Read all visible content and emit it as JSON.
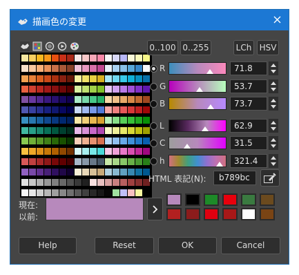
{
  "window": {
    "title": "描画色の変更",
    "close_label": "×"
  },
  "tabs": [
    "wilber-icon",
    "palette-icon",
    "circle-icon",
    "play-circle-icon",
    "paint-palette-icon"
  ],
  "range_buttons": {
    "range_100": "0..100",
    "range_255": "0..255"
  },
  "model_buttons": {
    "lch": "LCh",
    "hsv": "HSV"
  },
  "channels": [
    {
      "id": "r",
      "label": "R",
      "value": "71.8",
      "selected": true,
      "gradient": "linear-gradient(90deg,#3c8fbc,#b789bc,#fb89bc)",
      "pos": 0.718
    },
    {
      "id": "g",
      "label": "G",
      "value": "53.7",
      "selected": false,
      "gradient": "linear-gradient(90deg,#b700bc,#b789bc,#b7ffbc)",
      "pos": 0.537
    },
    {
      "id": "b",
      "label": "B",
      "value": "73.7",
      "selected": false,
      "gradient": "linear-gradient(90deg,#b78900,#b789bc,#b789ff)",
      "pos": 0.737
    },
    {
      "id": "l",
      "label": "L",
      "value": "62.9",
      "selected": false,
      "gradient": "linear-gradient(90deg,#000,#5a2a60,#b789bc,#ff00ff)",
      "pos": 0.629
    },
    {
      "id": "c",
      "label": "C",
      "value": "31.5",
      "selected": false,
      "gradient": "linear-gradient(90deg,#9d9d9d,#b789bc,#e100ff)",
      "pos": 0.315
    },
    {
      "id": "h",
      "label": "h",
      "value": "321.4",
      "selected": false,
      "gradient": "linear-gradient(90deg,#d07080,#a08a30,#40a080,#4090d0,#9070d0,#c070b0,#d07080)",
      "pos": 0.893
    }
  ],
  "html_notation": {
    "label": "HTML 表記(N):",
    "value": "b789bc"
  },
  "current": {
    "label_current": "現在:",
    "label_previous": "以前:",
    "color": "#b789bc"
  },
  "history_colors": [
    "#b789bc",
    "#000000",
    "#1d8a28",
    "#e8000c",
    "#3a7a40",
    "#6b4a1e",
    "#b22020",
    "#8c1c1c",
    "#e00010",
    "#a81818",
    "#ffffff",
    "#7a4414"
  ],
  "footer": {
    "help": "Help",
    "reset": "Reset",
    "ok": "OK",
    "cancel": "Cancel"
  },
  "palette_rows": [
    [
      "#f8e8a0",
      "#f8d060",
      "#f8b820",
      "#f89818",
      "#e85010",
      "#c83018",
      "#a82818",
      "#f8e8e8",
      "#f8c8c8",
      "#f8a8b8",
      "#f888a8",
      "#f8f8f8",
      "#d8d8f8",
      "#b8b8f8",
      "#f8f8d8",
      "#f8f8b8",
      "#f8f888"
    ],
    [
      "#f8e0c8",
      "#f8c8a0",
      "#f8b078",
      "#e89058",
      "#c87048",
      "#a85838",
      "#884028",
      "#f0c0d8",
      "#e898c0",
      "#d870a8",
      "#c04890",
      "#e8f0f8",
      "#a8d0f0",
      "#88c0e8",
      "#58a8d8",
      "#3888c8",
      "#f8f8f8"
    ],
    [
      "#f0a050",
      "#e88038",
      "#d86020",
      "#c84818",
      "#a83010",
      "#882010",
      "#681808",
      "#f8f0a0",
      "#f0e068",
      "#e8d040",
      "#d8b020",
      "#a8e8f8",
      "#70d8f0",
      "#38c8e8",
      "#10b0d8",
      "#0890c0",
      "#0870a8"
    ],
    [
      "#e86040",
      "#d04030",
      "#b82820",
      "#a01818",
      "#881010",
      "#700808",
      "#580000",
      "#d8f0a0",
      "#c0e070",
      "#a0d048",
      "#80c028",
      "#e8c8f8",
      "#d0a0f0",
      "#b878e8",
      "#a050d8",
      "#8030c8",
      "#6018b0"
    ],
    [
      "#8050a0",
      "#6838a0",
      "#502890",
      "#381880",
      "#281070",
      "#180860",
      "#100050",
      "#a8e8c8",
      "#78d8a8",
      "#48c888",
      "#28b068",
      "#f8d8a8",
      "#f0c088",
      "#e8a868",
      "#d88848",
      "#c06830",
      "#a04820"
    ],
    [
      "#5058b0",
      "#3840a0",
      "#283090",
      "#182080",
      "#101870",
      "#080860",
      "#000050",
      "#c8d8f8",
      "#a0b8f0",
      "#7898e8",
      "#5078d8",
      "#f8a8a8",
      "#f08080",
      "#e85858",
      "#d83838",
      "#c02020",
      "#a00808"
    ],
    [
      "#3890c0",
      "#2878b0",
      "#1860a0",
      "#104890",
      "#083880",
      "#002870",
      "#002060",
      "#f8e8a8",
      "#f0d078",
      "#e8b850",
      "#d8a030",
      "#b8f0b8",
      "#88e088",
      "#58d058",
      "#38c038",
      "#20a820",
      "#089008"
    ],
    [
      "#40b8a0",
      "#28a088",
      "#188870",
      "#087058",
      "#005840",
      "#004030",
      "#003020",
      "#e8b8e8",
      "#d890d8",
      "#c868c8",
      "#b048b0",
      "#f8f8c8",
      "#f0f098",
      "#e8e868",
      "#d8d838",
      "#c0c010",
      "#a0a000"
    ],
    [
      "#88c850",
      "#70b038",
      "#589828",
      "#408018",
      "#286808",
      "#185000",
      "#083800",
      "#f8d0b8",
      "#f0b090",
      "#e89070",
      "#d87050",
      "#b8d8f8",
      "#90c0f0",
      "#68a8e8",
      "#4090d8",
      "#2078c8",
      "#0860b0"
    ],
    [
      "#f8c040",
      "#f0a828",
      "#e09018",
      "#c87808",
      "#b06000",
      "#904800",
      "#703000",
      "#d8f8f8",
      "#a8f0f0",
      "#78e8e8",
      "#48d8d8",
      "#f8c8e8",
      "#f0a0d8",
      "#e878c8",
      "#d850b0",
      "#c02898",
      "#a00880"
    ],
    [
      "#d85858",
      "#c04040",
      "#a82828",
      "#901818",
      "#780808",
      "#600000",
      "#480000",
      "#a8b8c8",
      "#8898a8",
      "#687888",
      "#485868",
      "#c8e8a8",
      "#a8d888",
      "#88c868",
      "#68b048",
      "#489830",
      "#288018"
    ],
    [
      "#9060c0",
      "#7848a8",
      "#603090",
      "#482078",
      "#301060",
      "#200848",
      "#100030",
      "#f8f0d8",
      "#e8d8b8",
      "#d8c098",
      "#c8a878",
      "#b0d0e0",
      "#88b8d0",
      "#60a0c0",
      "#3888b0",
      "#1070a0",
      "#005890"
    ],
    [
      "#e0e0e0",
      "#c8c8c8",
      "#b0b0b0",
      "#989898",
      "#808080",
      "#686868",
      "#505050",
      "#383838",
      "#202020",
      "#f8e0e0",
      "#e8c0c0",
      "#d8a0a0",
      "#c88080",
      "#b86060",
      "#a04040",
      "#883030",
      "#702020"
    ],
    [
      "#f8f8f8",
      "#e8e8e8",
      "#d0d0d0",
      "#b8b8b8",
      "#a0a0a0",
      "#888888",
      "#707070",
      "#585858",
      "#404040",
      "#282828",
      "#181818",
      "#080808",
      "#a0e0a0",
      "#c0c0f8",
      "#f8c0c0",
      "#f8f8a0",
      "#000000"
    ]
  ]
}
